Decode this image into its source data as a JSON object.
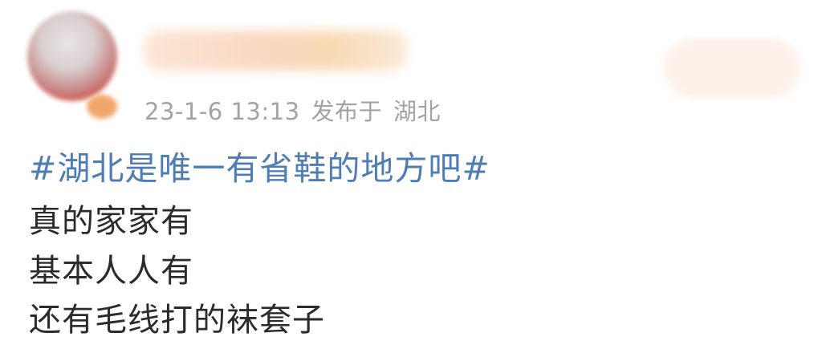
{
  "post": {
    "date": "23-1-6 13:13",
    "published_label": "发布于",
    "location": "湖北",
    "hashtag": "#湖北是唯一有省鞋的地方吧#",
    "lines": [
      "真的家家有",
      "基本人人有",
      "还有毛线打的袜套子"
    ]
  },
  "colors": {
    "hashtag": "#4f7db3",
    "body_text": "#2b2b2b",
    "meta_text": "#a3a3a3"
  }
}
